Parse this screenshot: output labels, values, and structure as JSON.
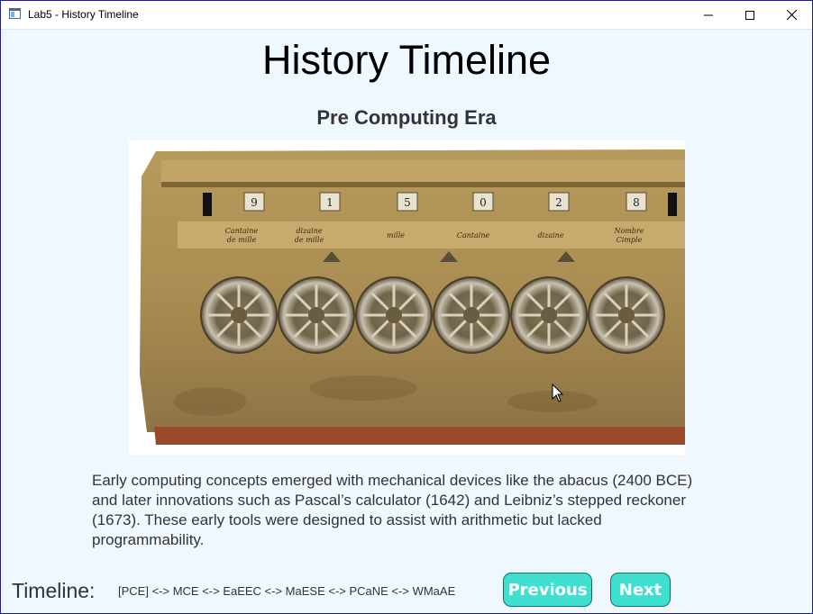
{
  "window": {
    "title": "Lab5 - History Timeline",
    "controls": [
      "minimize-icon",
      "maximize-icon",
      "close-icon"
    ]
  },
  "header": {
    "title": "History Timeline",
    "era": "Pre Computing Era"
  },
  "image": {
    "subject": "pascaline-mechanical-calculator",
    "labels": [
      "Cantaine de mille",
      "dizaine de mille",
      "mille",
      "Cantaine",
      "dizaine",
      "Nombre Cimple"
    ],
    "digits": [
      "9",
      "1",
      "5",
      "0",
      "2",
      "8"
    ]
  },
  "description": "Early computing concepts emerged with mechanical devices like the abacus (2400 BCE) and later innovations such as Pascal’s calculator (1642) and Leibniz’s stepped reckoner (1673). These early tools were designed to assist with arithmetic but lacked programmability.",
  "timeline": {
    "label": "Timeline:",
    "sequence": "[PCE] <-> MCE <-> EaEEC <-> MaESE <-> PCaNE <-> WMaAE"
  },
  "buttons": {
    "previous": "Previous",
    "next": "Next"
  },
  "colors": {
    "background": "#f0f8ff",
    "button": "#40e0d0",
    "button_text": "#ffffff",
    "window_border": "#1e1e8c"
  }
}
